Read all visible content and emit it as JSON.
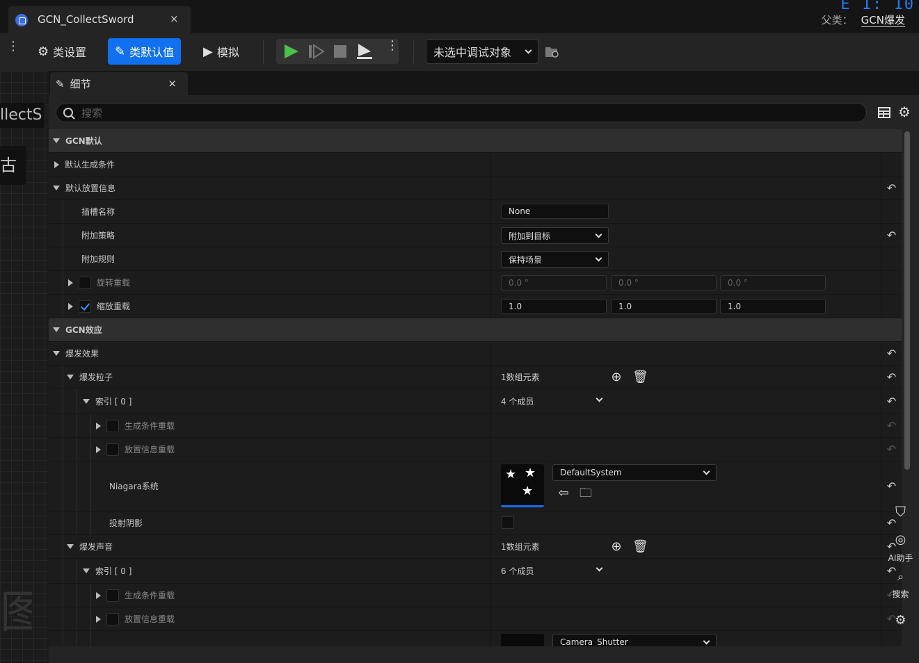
{
  "window": {
    "tab_title": "GCN_CollectSword",
    "tab_close": "×",
    "parent_label": "父类：",
    "parent_value": "GCN爆发",
    "corner_digits": "E 1: 10"
  },
  "toolbar": {
    "class_settings": "类设置",
    "class_defaults": "类默认值",
    "simulate": "模拟",
    "debug_select": "未选中调试对象"
  },
  "details_tab": {
    "label": "细节",
    "close": "×"
  },
  "search": {
    "placeholder": "搜索"
  },
  "left_strip": {
    "t1": "llectS",
    "t2": "古 ɾ",
    "t3": "图"
  },
  "rows": {
    "cat1": "GCN默认",
    "default_spawn": "默认生成条件",
    "default_place": "默认放置信息",
    "socket_name": "插槽名称",
    "socket_value": "None",
    "attach_policy": "附加策略",
    "attach_policy_value": "附加到目标",
    "attach_rule": "附加规则",
    "attach_rule_value": "保持场景",
    "rot_override": "旋转重载",
    "rot_values": [
      "0.0 °",
      "0.0 °",
      "0.0 °"
    ],
    "scale_override": "缩放重载",
    "scale_values": [
      "1.0",
      "1.0",
      "1.0"
    ],
    "cat2": "GCN效应",
    "burst_effects": "爆发效果",
    "burst_particles": "爆发粒子",
    "burst_particles_count": "1数组元素",
    "index0": "索引 [ 0 ]",
    "members4": "4 个成员",
    "spawn_override": "生成条件重载",
    "place_override": "放置信息重载",
    "niagara": "Niagara系统",
    "niagara_value": "DefaultSystem",
    "cast_shadow": "投射阴影",
    "burst_sounds": "爆发声音",
    "burst_sounds_count": "1数组元素",
    "index0b": "索引 [ 0 ]",
    "members6": "6 个成员",
    "spawn_override2": "生成条件重载",
    "place_override2": "放置信息重载",
    "sound_value": "Camera_Shutter"
  },
  "side": {
    "ai": "AI助手",
    "search": "搜索"
  }
}
